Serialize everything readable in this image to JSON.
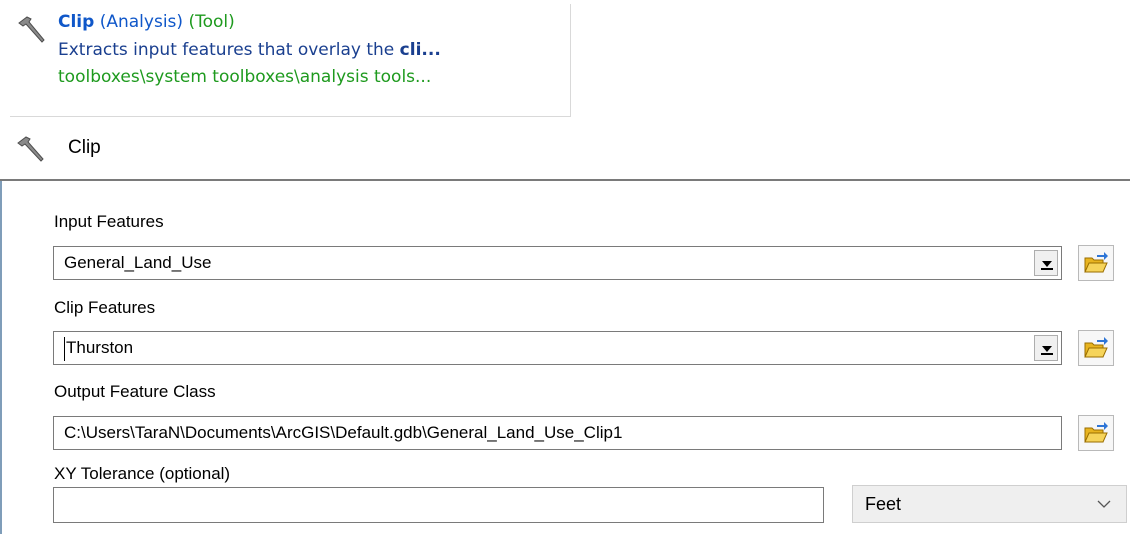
{
  "search_result": {
    "tool_name": "Clip",
    "toolbox": "(Analysis)",
    "kind": "(Tool)",
    "description_prefix": "Extracts input features that overlay the ",
    "description_bold": "cli...",
    "path": "toolboxes\\system toolboxes\\analysis tools..."
  },
  "dialog": {
    "title": "Clip",
    "fields": {
      "input_features": {
        "label": "Input Features",
        "value": "General_Land_Use"
      },
      "clip_features": {
        "label": "Clip Features",
        "value": "Thurston"
      },
      "output_feature_class": {
        "label": "Output Feature Class",
        "value": "C:\\Users\\TaraN\\Documents\\ArcGIS\\Default.gdb\\General_Land_Use_Clip1"
      },
      "xy_tolerance": {
        "label": "XY Tolerance (optional)",
        "value": "",
        "unit": "Feet"
      }
    }
  },
  "icons": {
    "tool": "hammer-icon",
    "browse": "open-folder-icon",
    "dropdown": "dropdown-arrow-icon",
    "chevron": "chevron-down-icon"
  },
  "colors": {
    "link_blue": "#0f57c9",
    "path_green": "#1e9a1e",
    "folder_yellow": "#f2c230"
  }
}
